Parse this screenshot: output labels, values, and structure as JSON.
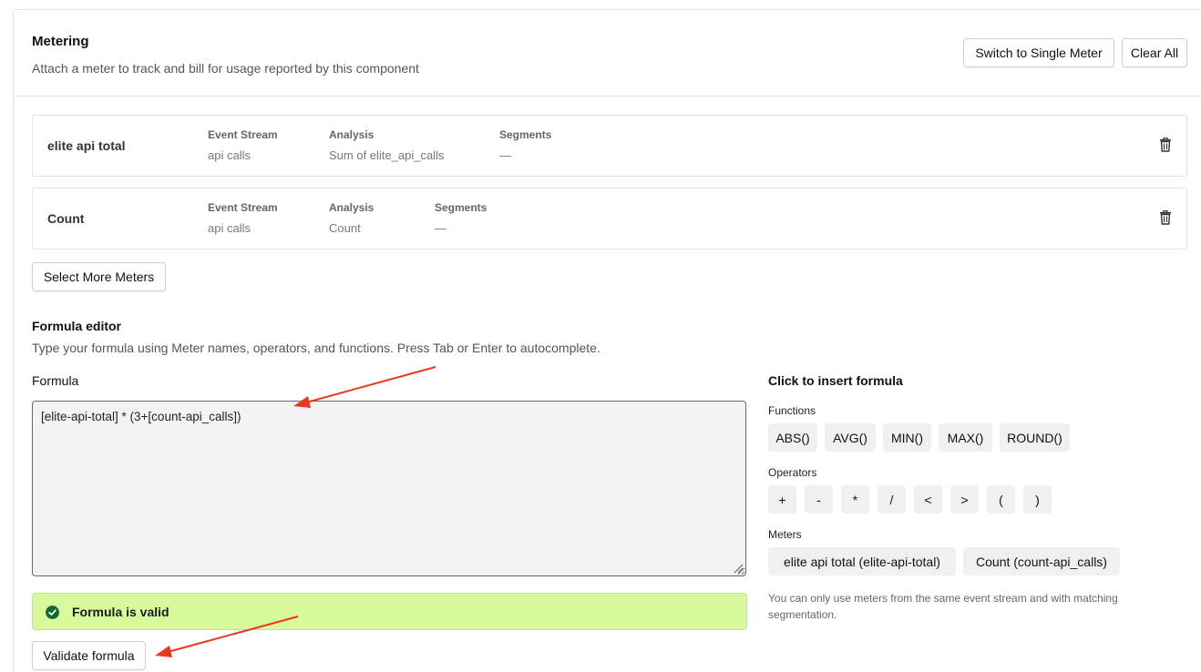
{
  "header": {
    "title": "Metering",
    "subtitle": "Attach a meter to track and bill for usage reported by this component",
    "switch_label": "Switch to Single Meter",
    "clear_label": "Clear All"
  },
  "meters": [
    {
      "name": "elite api total",
      "event_stream_label": "Event Stream",
      "event_stream": "api calls",
      "analysis_label": "Analysis",
      "analysis": "Sum of elite_api_calls",
      "segments_label": "Segments",
      "segments": "—"
    },
    {
      "name": "Count",
      "event_stream_label": "Event Stream",
      "event_stream": "api calls",
      "analysis_label": "Analysis",
      "analysis": "Count",
      "segments_label": "Segments",
      "segments": "—"
    }
  ],
  "select_more_label": "Select More Meters",
  "formula_editor": {
    "title": "Formula editor",
    "description": "Type your formula using Meter names, operators, and functions. Press Tab or Enter to autocomplete.",
    "formula_label": "Formula",
    "formula_value": "[elite-api-total] * (3+[count-api_calls])",
    "valid_text": "Formula is valid",
    "validate_label": "Validate formula"
  },
  "insert_panel": {
    "title": "Click to insert formula",
    "functions_label": "Functions",
    "functions": [
      "ABS()",
      "AVG()",
      "MIN()",
      "MAX()",
      "ROUND()"
    ],
    "operators_label": "Operators",
    "operators": [
      "+",
      "-",
      "*",
      "/",
      "<",
      ">",
      "(",
      ")"
    ],
    "meters_label": "Meters",
    "meters": [
      "elite api total (elite-api-total)",
      "Count (count-api_calls)"
    ],
    "note": "You can only use meters from the same event stream and with matching segmentation."
  },
  "colors": {
    "valid_bg": "#d9f99d",
    "valid_icon": "#166534",
    "annotation_arrow": "#e8391c"
  }
}
